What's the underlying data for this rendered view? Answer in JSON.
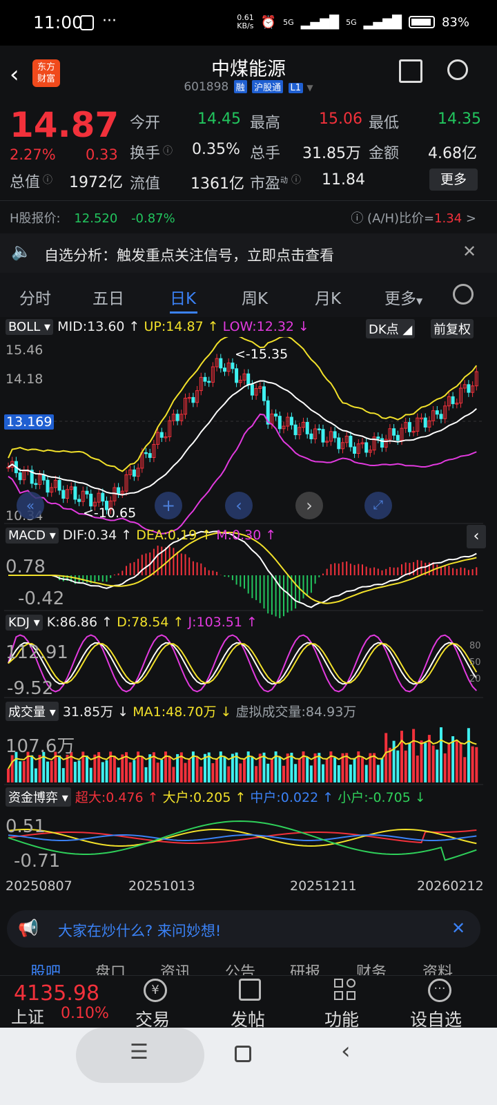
{
  "status_bar": {
    "time": "11:00",
    "net_speed": "0.61\nKB/s",
    "battery": "83%",
    "signal1": "5G",
    "signal2": "5G"
  },
  "header": {
    "title": "中煤能源",
    "code": "601898",
    "tag1": "融",
    "tag2": "沪股通",
    "tag3": "L1",
    "logo_line1": "东方",
    "logo_line2": "财富"
  },
  "quote": {
    "price": "14.87",
    "change_pct": "2.27%",
    "change": "0.33",
    "open_label": "今开",
    "open": "14.45",
    "high_label": "最高",
    "high": "15.06",
    "low_label": "最低",
    "low": "14.35",
    "turnover_label": "换手",
    "turnover": "0.35%",
    "volume_label": "总手",
    "volume": "31.85万",
    "amount_label": "金额",
    "amount": "4.68亿",
    "mktcap_label": "总值",
    "mktcap": "1972亿",
    "float_label": "流值",
    "float": "1361亿",
    "pe_label": "市盈",
    "pe_sup": "动",
    "pe": "11.84",
    "more_button": "更多"
  },
  "hshare": {
    "label": "H股报价:",
    "price": "12.520",
    "change": "-0.87%",
    "ah_label": "(A/H)比价=",
    "ah_value": "1.34",
    "chevron": ">"
  },
  "alert": {
    "text": "自选分析：触发重点关注信号，立即点击查看"
  },
  "tabs": [
    "分时",
    "五日",
    "日K",
    "周K",
    "月K",
    "更多"
  ],
  "active_tab": "日K",
  "boll": {
    "name": "BOLL",
    "mid": "MID:13.60",
    "up": "UP:14.87",
    "low": "LOW:12.32",
    "dk": "DK点",
    "fq": "前复权",
    "y_top": "15.46",
    "y_2": "14.18",
    "y_cur": "13.169",
    "y_bottom": "10.34",
    "max_note": "<-15.35",
    "min_note": "<-10.65"
  },
  "macd": {
    "name": "MACD",
    "dif": "DIF:0.34",
    "dea": "DEA:0.19",
    "m": "M:0.30",
    "y_top": "0.78",
    "y_bottom": "-0.42"
  },
  "kdj": {
    "name": "KDJ",
    "k": "K:86.86",
    "d": "D:78.54",
    "j": "J:103.51",
    "y_top": "112.91",
    "y_bottom": "-9.52",
    "r80": "80",
    "r50": "50",
    "r20": "20"
  },
  "vol": {
    "name": "成交量",
    "vol": "31.85万",
    "ma1": "MA1:48.70万",
    "virt": "虚拟成交量:84.93万",
    "y_top": "107.6万"
  },
  "fund": {
    "name": "资金博弈",
    "super": "超大:0.476",
    "big": "大户:0.205",
    "mid": "中户:0.022",
    "small": "小户:-0.705",
    "y_top": "0.51",
    "y_bottom": "-0.71"
  },
  "dates": [
    "20250807",
    "20251013",
    "20251211",
    "20260212"
  ],
  "ask": {
    "text": "大家在炒什么? 来问妙想!"
  },
  "sub_tabs": [
    "股吧",
    "盘口",
    "资讯",
    "公告",
    "研报",
    "财务",
    "资料"
  ],
  "bottom": {
    "index_value": "4135.98",
    "index_name": "上证",
    "index_pct": "0.10%",
    "trade": "交易",
    "post": "发帖",
    "func": "功能",
    "watch": "设自选"
  },
  "colors": {
    "up": "#f2313b",
    "down": "#22c55e",
    "accent": "#3b82f6",
    "yellow": "#f2e12a",
    "magenta": "#e23adf"
  }
}
